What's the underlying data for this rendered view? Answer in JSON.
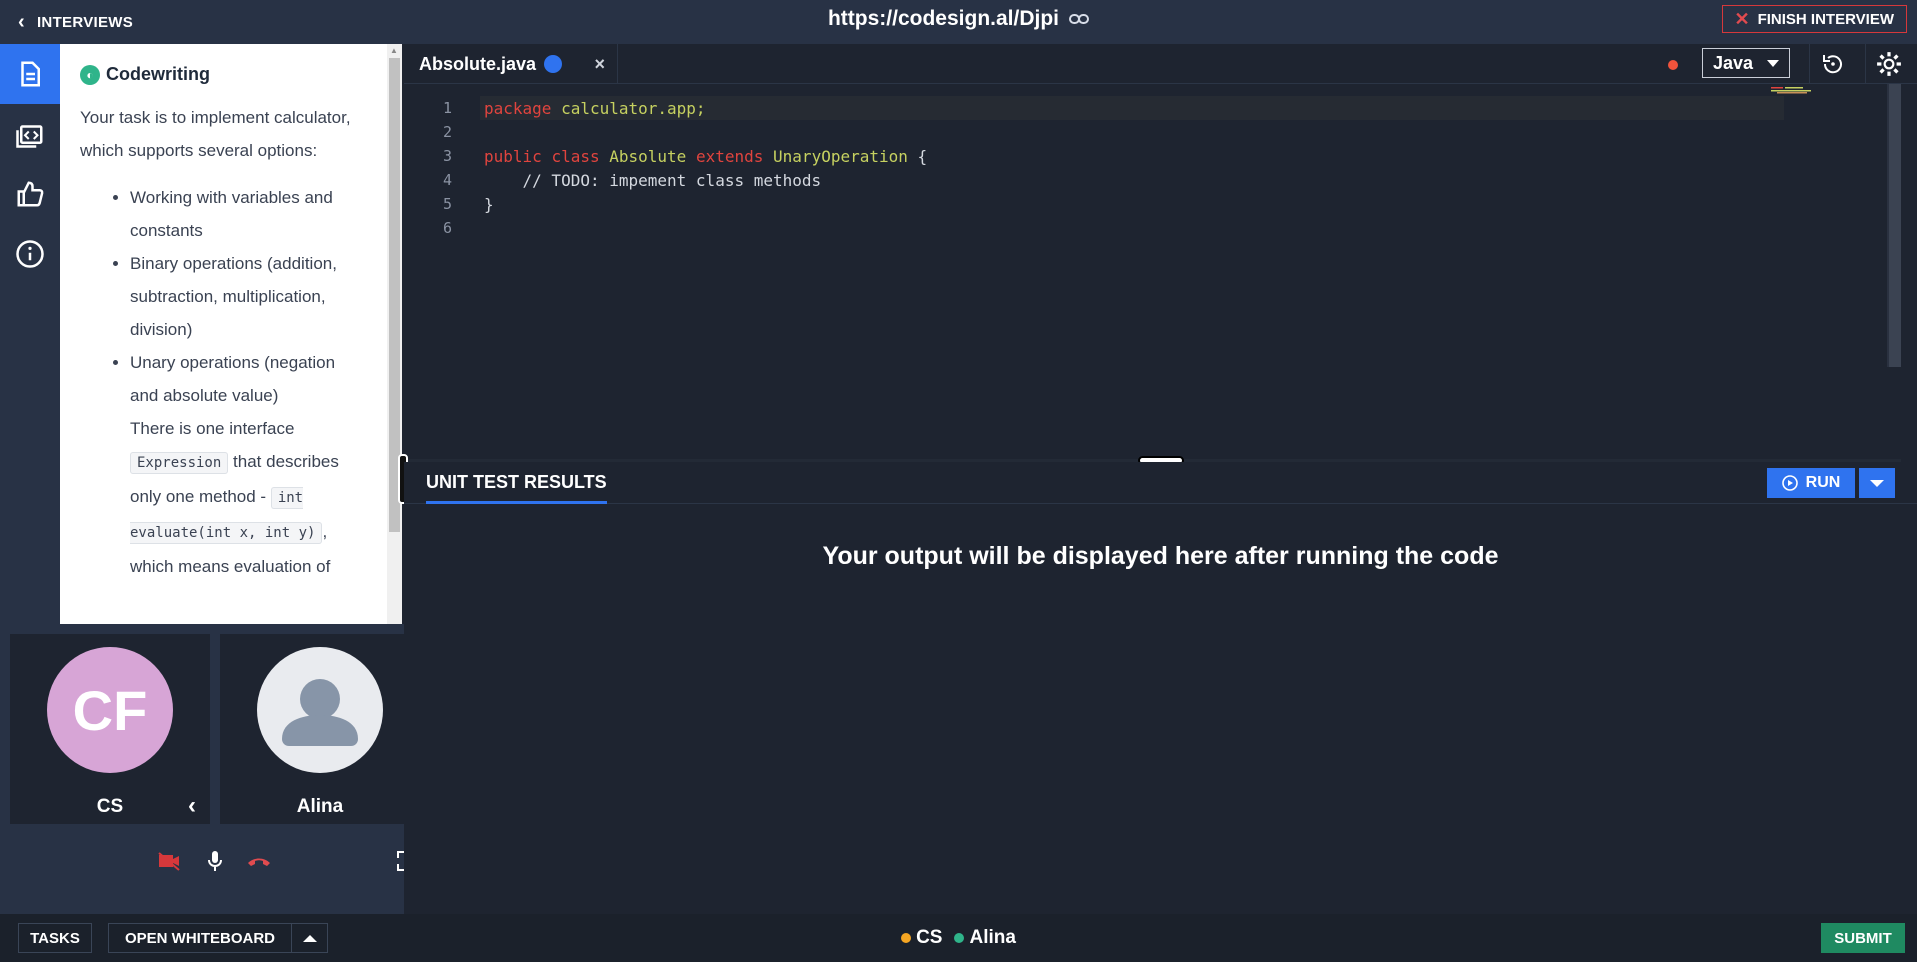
{
  "header": {
    "back_label": "INTERVIEWS",
    "url": "https://codesign.al/Djpi",
    "finish_label": "FINISH INTERVIEW"
  },
  "rail": {
    "items": [
      "task-icon",
      "code-review-icon",
      "feedback-icon",
      "info-icon"
    ]
  },
  "task": {
    "title": "Codewriting",
    "intro": "Your task is to implement calculator, which supports several options:",
    "bullets": [
      "Working with variables and constants",
      "Binary operations (addition, subtraction, multiplication, division)",
      "Unary operations (negation and absolute value)"
    ],
    "para_pre": "There is one interface",
    "code1": "Expression",
    "para_mid": "that describes only one method -",
    "code2": "int evaluate(int x, int y)",
    "para_post": ", which means evaluation of"
  },
  "video": {
    "participants": [
      {
        "initials": "CF",
        "name": "CS"
      },
      {
        "initials": "",
        "name": "Alina"
      }
    ]
  },
  "editor": {
    "tab_name": "Absolute.java",
    "language": "Java",
    "line_numbers": [
      "1",
      "2",
      "3",
      "4",
      "5",
      "6"
    ],
    "lines": {
      "l1_kw": "package",
      "l1_rest": " calculator.app;",
      "l3_kw1": "public",
      "l3_kw2": "class",
      "l3_name": "Absolute",
      "l3_kw3": "extends",
      "l3_parent": "UnaryOperation",
      "l3_brace": " {",
      "l4_comment": "    // TODO: impement class methods",
      "l5": "}"
    }
  },
  "results": {
    "tab_label": "UNIT TEST RESULTS",
    "run_label": "RUN",
    "placeholder": "Your output will be displayed here after running the code"
  },
  "footer": {
    "tasks_label": "TASKS",
    "whiteboard_label": "OPEN WHITEBOARD",
    "presence": [
      {
        "name": "CS",
        "color": "#f5a623"
      },
      {
        "name": "Alina",
        "color": "#2fb48a"
      }
    ],
    "submit_label": "SUBMIT"
  },
  "colors": {
    "accent": "#2f73ef",
    "danger": "#d6383b",
    "success": "#1f8a61"
  }
}
